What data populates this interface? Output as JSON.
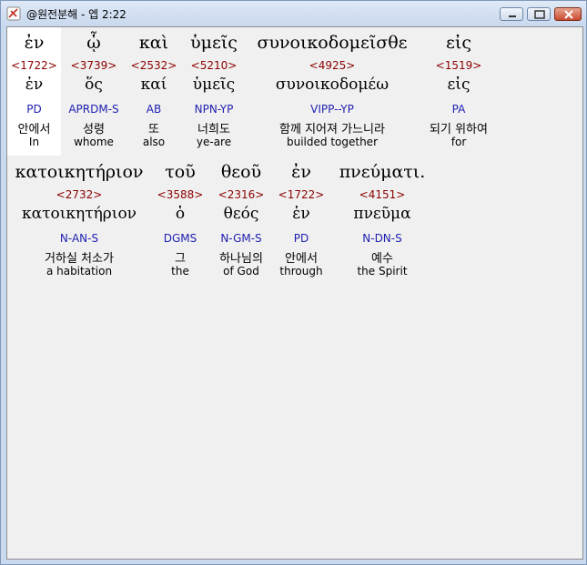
{
  "window": {
    "title": "@원전분해 - 엡 2:22"
  },
  "rows": [
    {
      "words": [
        {
          "greek": "ἐν",
          "strong": "<1722>",
          "lemma": "ἐν",
          "morph": "PD",
          "korean": "안에서",
          "english": "In"
        },
        {
          "greek": "ᾧ",
          "strong": "<3739>",
          "lemma": "ὅς",
          "morph": "APRDM-S",
          "korean": "성령",
          "english": "whome"
        },
        {
          "greek": "καὶ",
          "strong": "<2532>",
          "lemma": "καί",
          "morph": "AB",
          "korean": "또",
          "english": "also"
        },
        {
          "greek": "ὑμεῖς",
          "strong": "<5210>",
          "lemma": "ὑμεῖς",
          "morph": "NPN-YP",
          "korean": "너희도",
          "english": "ye-are"
        },
        {
          "greek": "συνοικοδομεῖσθε",
          "strong": "<4925>",
          "lemma": "συνοικοδομέω",
          "morph": "VIPP--YP",
          "korean": "함께 지어져 가느니라",
          "english": "builded together"
        },
        {
          "greek": "εἰς",
          "strong": "<1519>",
          "lemma": "εἰς",
          "morph": "PA",
          "korean": "되기 위하여",
          "english": "for"
        }
      ]
    },
    {
      "words": [
        {
          "greek": "κατοικητήριον",
          "strong": "<2732>",
          "lemma": "κατοικητήριον",
          "morph": "N-AN-S",
          "korean": "거하실 처소가",
          "english": "a habitation"
        },
        {
          "greek": "τοῦ",
          "strong": "<3588>",
          "lemma": "ὁ",
          "morph": "DGMS",
          "korean": "그",
          "english": "the"
        },
        {
          "greek": "θεοῦ",
          "strong": "<2316>",
          "lemma": "θεός",
          "morph": "N-GM-S",
          "korean": "하나님의",
          "english": "of God"
        },
        {
          "greek": "ἐν",
          "strong": "<1722>",
          "lemma": "ἐν",
          "morph": "PD",
          "korean": "안에서",
          "english": "through"
        },
        {
          "greek": "πνεύματι.",
          "strong": "<4151>",
          "lemma": "πνεῦμα",
          "morph": "N-DN-S",
          "korean": "예수",
          "english": "the Spirit"
        }
      ]
    }
  ],
  "colors": {
    "strong": "#8b0000",
    "morph": "#1f1fb0",
    "selected": "#ffffff"
  }
}
